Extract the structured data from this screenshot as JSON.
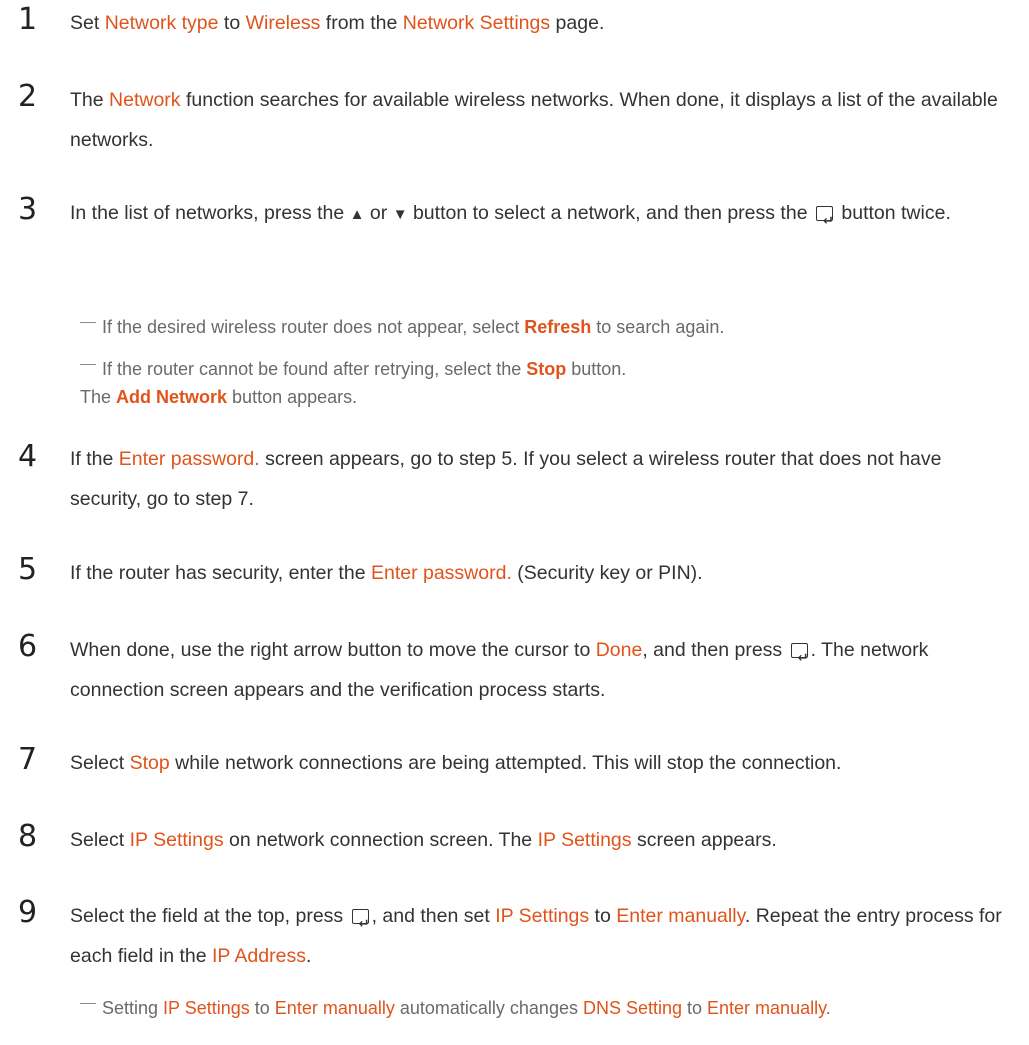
{
  "steps": {
    "s1": {
      "num": "1",
      "t1": "Set ",
      "h1": "Network type",
      "t2": " to ",
      "h2": "Wireless",
      "t3": " from the ",
      "h3": "Network Settings",
      "t4": " page."
    },
    "s2": {
      "num": "2",
      "t1": "The ",
      "h1": "Network",
      "t2": " function searches for available wireless networks. When done, it displays a list of the available networks."
    },
    "s3": {
      "num": "3",
      "t1": "In the list of networks, press the ",
      "up": "▲",
      "t2": " or ",
      "down": "▼",
      "t3": " button to select a network, and then press the ",
      "t4": " button twice."
    },
    "s4": {
      "num": "4",
      "t1": "If the ",
      "h1": "Enter password.",
      "t2": " screen appears, go to step 5. If you select a wireless router that does not have security, go to step 7."
    },
    "s5": {
      "num": "5",
      "t1": "If the router has security, enter the ",
      "h1": "Enter password.",
      "t2": " (Security key or PIN)."
    },
    "s6": {
      "num": "6",
      "t1": "When done, use the right arrow button to move the cursor to ",
      "h1": "Done",
      "t2": ", and then press ",
      "t3": ". The network connection screen appears and the verification process starts."
    },
    "s7": {
      "num": "7",
      "t1": "Select ",
      "h1": "Stop",
      "t2": " while network connections are being attempted. This will stop the connection."
    },
    "s8": {
      "num": "8",
      "t1": "Select ",
      "h1": "IP Settings",
      "t2": " on network connection screen. The ",
      "h2": "IP Settings",
      "t3": " screen appears."
    },
    "s9": {
      "num": "9",
      "t1": "Select the field at the top, press ",
      "t2": ", and then set ",
      "h1": "IP Settings",
      "t3": " to ",
      "h2": "Enter manually",
      "t4": ". Repeat the entry process for each field in the ",
      "h3": "IP Address",
      "t5": "."
    }
  },
  "notes": {
    "n1": {
      "t1": "If the desired wireless router does not appear, select ",
      "h1": "Refresh",
      "t2": " to search again."
    },
    "n2": {
      "t1": "If the router cannot be found after retrying, select the ",
      "h1": "Stop",
      "t2": " button.",
      "t3": "The ",
      "h2": "Add Network",
      "t4": " button appears."
    },
    "n3": {
      "t1": "Setting ",
      "h1": "IP Settings",
      "t2": " to ",
      "h2": "Enter manually",
      "t3": " automatically changes ",
      "h3": "DNS Setting",
      "t4": " to ",
      "h4": "Enter manually",
      "t5": "."
    }
  },
  "colors": {
    "highlight": "#e0541c",
    "text": "#333333",
    "note": "#6a6a6a"
  }
}
